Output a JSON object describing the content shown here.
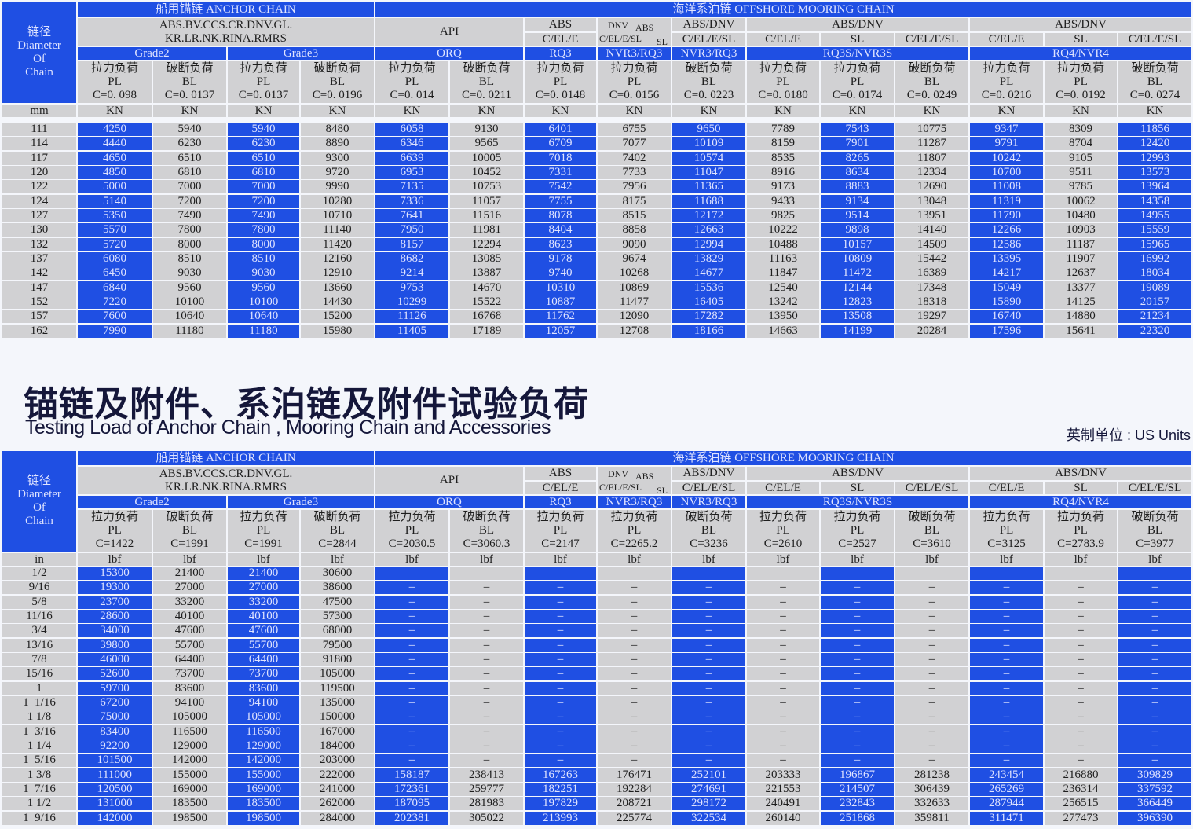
{
  "header": {
    "diameter": [
      "链径",
      "Diameter",
      "Of",
      "Chain"
    ],
    "anchor_title": "船用锚链  ANCHOR CHAIN",
    "offshore_title": "海洋系泊链    OFFSHORE MOORING CHAIN",
    "societies": [
      "ABS.BV.CCS.CR.DNV.GL.",
      "KR.LR.NK.RINA.RMRS"
    ],
    "api": "API",
    "abs": "ABS",
    "abs_type": "C/EL/E",
    "dnv": "DNV",
    "dnv_abs": "ABS",
    "dnv_type": "C/EL/E/SL",
    "dnv_sl": "SL",
    "absdnv_1": "ABS/DNV",
    "absdnv_1_type": "C/EL/E/SL",
    "absdnv_2": "ABS/DNV",
    "absdnv_2_types": [
      "C/EL/E",
      "SL",
      "C/EL/E/SL"
    ],
    "absdnv_3": "ABS/DNV",
    "absdnv_3_types": [
      "C/EL/E",
      "SL",
      "C/EL/E/SL"
    ],
    "grades": [
      "Grade2",
      "Grade3",
      "ORQ",
      "RQ3",
      "NVR3/RQ3",
      "NVR3/RQ3",
      "RQ3S/NVR3S",
      "RQ4/NVR4"
    ],
    "load_types": [
      {
        "cn": "拉力负荷",
        "en": "PL"
      },
      {
        "cn": "破断负荷",
        "en": "BL"
      },
      {
        "cn": "拉力负荷",
        "en": "PL"
      },
      {
        "cn": "破断负荷",
        "en": "BL"
      },
      {
        "cn": "拉力负荷",
        "en": "PL"
      },
      {
        "cn": "破断负荷",
        "en": "BL"
      },
      {
        "cn": "拉力负荷",
        "en": "PL"
      },
      {
        "cn": "拉力负荷",
        "en": "PL"
      },
      {
        "cn": "破断负荷",
        "en": "BL"
      },
      {
        "cn": "拉力负荷",
        "en": "PL"
      },
      {
        "cn": "拉力负荷",
        "en": "PL"
      },
      {
        "cn": "破断负荷",
        "en": "BL"
      },
      {
        "cn": "拉力负荷",
        "en": "PL"
      },
      {
        "cn": "拉力负荷",
        "en": "PL"
      },
      {
        "cn": "破断负荷",
        "en": "BL"
      }
    ]
  },
  "title_cn": "锚链及附件、系泊链及附件试验负荷",
  "title_en": "Testing Load of Anchor Chain , Mooring Chain and Accessories",
  "units_note": "英制单位 : US Units",
  "colors": {
    "blue": "#1f4fe3",
    "gray": "#d1d1d3",
    "title": "#15173a"
  },
  "tables": [
    {
      "diameter_unit": "mm",
      "coefficients": [
        "C=0. 098",
        "C=0. 0137",
        "C=0. 0137",
        "C=0. 0196",
        "C=0. 014",
        "C=0. 0211",
        "C=0. 0148",
        "C=0. 0156",
        "C=0. 0223",
        "C=0. 0180",
        "C=0. 0174",
        "C=0. 0249",
        "C=0. 0216",
        "C=0. 0192",
        "C=0. 0274"
      ],
      "units": [
        "KN",
        "KN",
        "KN",
        "KN",
        "KN",
        "KN",
        "KN",
        "KN",
        "KN",
        "KN",
        "KN",
        "KN",
        "KN",
        "KN",
        "KN"
      ],
      "rows": [
        [
          "111",
          "4250",
          "5940",
          "5940",
          "8480",
          "6058",
          "9130",
          "6401",
          "6755",
          "9650",
          "7789",
          "7543",
          "10775",
          "9347",
          "8309",
          "11856"
        ],
        [
          "114",
          "4440",
          "6230",
          "6230",
          "8890",
          "6346",
          "9565",
          "6709",
          "7077",
          "10109",
          "8159",
          "7901",
          "11287",
          "9791",
          "8704",
          "12420"
        ],
        [
          "117",
          "4650",
          "6510",
          "6510",
          "9300",
          "6639",
          "10005",
          "7018",
          "7402",
          "10574",
          "8535",
          "8265",
          "11807",
          "10242",
          "9105",
          "12993"
        ],
        [
          "120",
          "4850",
          "6810",
          "6810",
          "9720",
          "6953",
          "10452",
          "7331",
          "7733",
          "11047",
          "8916",
          "8634",
          "12334",
          "10700",
          "9511",
          "13573"
        ],
        [
          "122",
          "5000",
          "7000",
          "7000",
          "9990",
          "7135",
          "10753",
          "7542",
          "7956",
          "11365",
          "9173",
          "8883",
          "12690",
          "11008",
          "9785",
          "13964"
        ],
        [
          "124",
          "5140",
          "7200",
          "7200",
          "10280",
          "7336",
          "11057",
          "7755",
          "8175",
          "11688",
          "9433",
          "9134",
          "13048",
          "11319",
          "10062",
          "14358"
        ],
        [
          "127",
          "5350",
          "7490",
          "7490",
          "10710",
          "7641",
          "11516",
          "8078",
          "8515",
          "12172",
          "9825",
          "9514",
          "13951",
          "11790",
          "10480",
          "14955"
        ],
        [
          "130",
          "5570",
          "7800",
          "7800",
          "11140",
          "7950",
          "11981",
          "8404",
          "8858",
          "12663",
          "10222",
          "9898",
          "14140",
          "12266",
          "10903",
          "15559"
        ],
        [
          "132",
          "5720",
          "8000",
          "8000",
          "11420",
          "8157",
          "12294",
          "8623",
          "9090",
          "12994",
          "10488",
          "10157",
          "14509",
          "12586",
          "11187",
          "15965"
        ],
        [
          "137",
          "6080",
          "8510",
          "8510",
          "12160",
          "8682",
          "13085",
          "9178",
          "9674",
          "13829",
          "11163",
          "10809",
          "15442",
          "13395",
          "11907",
          "16992"
        ],
        [
          "142",
          "6450",
          "9030",
          "9030",
          "12910",
          "9214",
          "13887",
          "9740",
          "10268",
          "14677",
          "11847",
          "11472",
          "16389",
          "14217",
          "12637",
          "18034"
        ],
        [
          "147",
          "6840",
          "9560",
          "9560",
          "13660",
          "9753",
          "14670",
          "10310",
          "10869",
          "15536",
          "12540",
          "12144",
          "17348",
          "15049",
          "13377",
          "19089"
        ],
        [
          "152",
          "7220",
          "10100",
          "10100",
          "14430",
          "10299",
          "15522",
          "10887",
          "11477",
          "16405",
          "13242",
          "12823",
          "18318",
          "15890",
          "14125",
          "20157"
        ],
        [
          "157",
          "7600",
          "10640",
          "10640",
          "15200",
          "11126",
          "16768",
          "11762",
          "12090",
          "17282",
          "13950",
          "13508",
          "19297",
          "16740",
          "14880",
          "21234"
        ],
        [
          "162",
          "7990",
          "11180",
          "11180",
          "15980",
          "11405",
          "17189",
          "12057",
          "12708",
          "18166",
          "14663",
          "14199",
          "20284",
          "17596",
          "15641",
          "22320"
        ]
      ]
    },
    {
      "diameter_unit": "in",
      "coefficients": [
        "C=1422",
        "C=1991",
        "C=1991",
        "C=2844",
        "C=2030.5",
        "C=3060.3",
        "C=2147",
        "C=2265.2",
        "C=3236",
        "C=2610",
        "C=2527",
        "C=3610",
        "C=3125",
        "C=2783.9",
        "C=3977"
      ],
      "units": [
        "lbf",
        "lbf",
        "lbf",
        "lbf",
        "lbf",
        "lbf",
        "lbf",
        "lbf",
        "lbf",
        "lbf",
        "lbf",
        "lbf",
        "lbf",
        "lbf",
        "lbf"
      ],
      "rows": [
        [
          "1/2",
          "15300",
          "21400",
          "21400",
          "30600",
          "",
          "",
          "",
          "",
          "",
          "",
          "",
          "",
          "",
          "",
          ""
        ],
        [
          "9/16",
          "19300",
          "27000",
          "27000",
          "38600",
          "–",
          "–",
          "–",
          "–",
          "–",
          "–",
          "–",
          "–",
          "–",
          "–",
          "–"
        ],
        [
          "5/8",
          "23700",
          "33200",
          "33200",
          "47500",
          "–",
          "–",
          "–",
          "–",
          "–",
          "–",
          "–",
          "–",
          "–",
          "–",
          "–"
        ],
        [
          "11/16",
          "28600",
          "40100",
          "40100",
          "57300",
          "–",
          "–",
          "–",
          "–",
          "–",
          "–",
          "–",
          "–",
          "–",
          "–",
          "–"
        ],
        [
          "3/4",
          "34000",
          "47600",
          "47600",
          "68000",
          "–",
          "–",
          "–",
          "–",
          "–",
          "–",
          "–",
          "–",
          "–",
          "–",
          "–"
        ],
        [
          "13/16",
          "39800",
          "55700",
          "55700",
          "79500",
          "–",
          "–",
          "–",
          "–",
          "–",
          "–",
          "–",
          "–",
          "–",
          "–",
          "–"
        ],
        [
          "7/8",
          "46000",
          "64400",
          "64400",
          "91800",
          "–",
          "–",
          "–",
          "–",
          "–",
          "–",
          "–",
          "–",
          "–",
          "–",
          "–"
        ],
        [
          "15/16",
          "52600",
          "73700",
          "73700",
          "105000",
          "–",
          "–",
          "–",
          "–",
          "–",
          "–",
          "–",
          "–",
          "–",
          "–",
          "–"
        ],
        [
          "1",
          "59700",
          "83600",
          "83600",
          "119500",
          "–",
          "–",
          "–",
          "–",
          "–",
          "–",
          "–",
          "–",
          "–",
          "–",
          "–"
        ],
        [
          "1  1/16",
          "67200",
          "94100",
          "94100",
          "135000",
          "–",
          "–",
          "–",
          "–",
          "–",
          "–",
          "–",
          "–",
          "–",
          "–",
          "–"
        ],
        [
          "1 1/8",
          "75000",
          "105000",
          "105000",
          "150000",
          "–",
          "–",
          "–",
          "–",
          "–",
          "–",
          "–",
          "–",
          "–",
          "–",
          "–"
        ],
        [
          "1  3/16",
          "83400",
          "116500",
          "116500",
          "167000",
          "–",
          "–",
          "–",
          "–",
          "–",
          "–",
          "–",
          "–",
          "–",
          "–",
          "–"
        ],
        [
          "1 1/4",
          "92200",
          "129000",
          "129000",
          "184000",
          "–",
          "–",
          "–",
          "–",
          "–",
          "–",
          "–",
          "–",
          "–",
          "–",
          "–"
        ],
        [
          "1  5/16",
          "101500",
          "142000",
          "142000",
          "203000",
          "–",
          "–",
          "–",
          "–",
          "–",
          "–",
          "–",
          "–",
          "–",
          "–",
          "–"
        ],
        [
          "1 3/8",
          "111000",
          "155000",
          "155000",
          "222000",
          "158187",
          "238413",
          "167263",
          "176471",
          "252101",
          "203333",
          "196867",
          "281238",
          "243454",
          "216880",
          "309829"
        ],
        [
          "1  7/16",
          "120500",
          "169000",
          "169000",
          "241000",
          "172361",
          "259777",
          "182251",
          "192284",
          "274691",
          "221553",
          "214507",
          "306439",
          "265269",
          "236314",
          "337592"
        ],
        [
          "1 1/2",
          "131000",
          "183500",
          "183500",
          "262000",
          "187095",
          "281983",
          "197829",
          "208721",
          "298172",
          "240491",
          "232843",
          "332633",
          "287944",
          "256515",
          "366449"
        ],
        [
          "1  9/16",
          "142000",
          "198500",
          "198500",
          "284000",
          "202381",
          "305022",
          "213993",
          "225774",
          "322534",
          "260140",
          "251868",
          "359811",
          "311471",
          "277473",
          "396390"
        ]
      ]
    }
  ]
}
